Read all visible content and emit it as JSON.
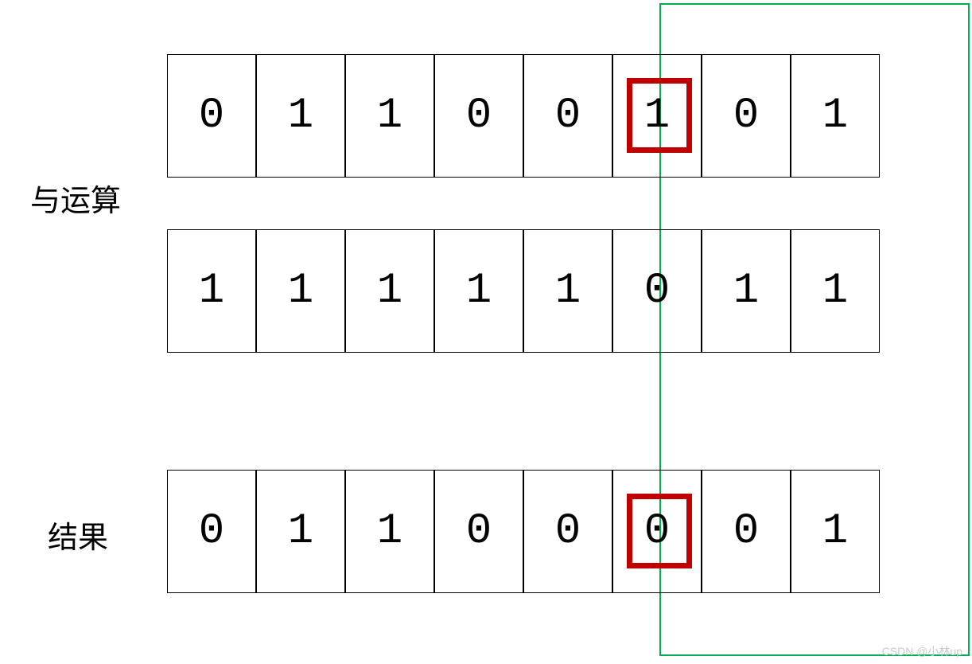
{
  "labels": {
    "andOperation": "与运算",
    "result": "结果"
  },
  "rows": {
    "operand1": [
      "0",
      "1",
      "1",
      "0",
      "0",
      "1",
      "0",
      "1"
    ],
    "operand2": [
      "1",
      "1",
      "1",
      "1",
      "1",
      "0",
      "1",
      "1"
    ],
    "result": [
      "0",
      "1",
      "1",
      "0",
      "0",
      "0",
      "0",
      "1"
    ]
  },
  "highlight": {
    "bitIndex": 5,
    "color": "#c00000"
  },
  "greenBox": {
    "color": "#00b050"
  },
  "watermark": "CSDN @小林up"
}
